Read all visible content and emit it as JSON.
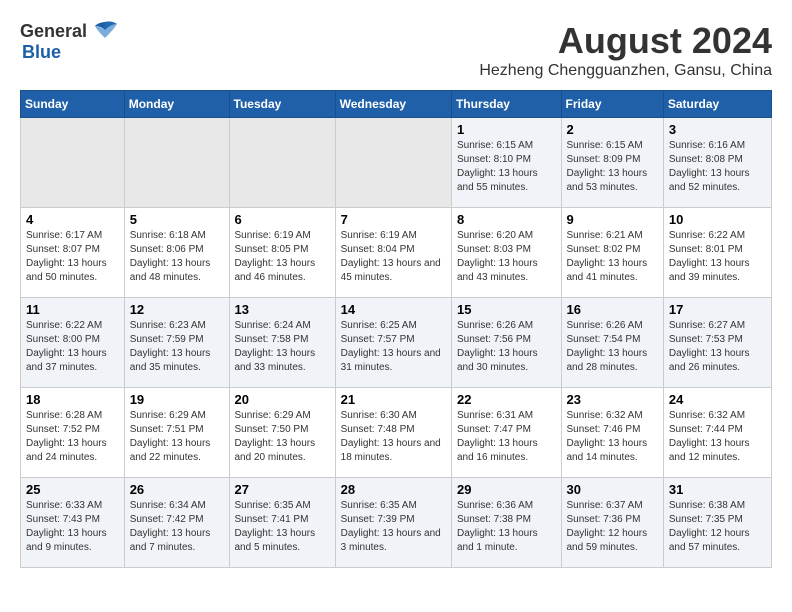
{
  "logo": {
    "general": "General",
    "blue": "Blue"
  },
  "title": "August 2024",
  "subtitle": "Hezheng Chengguanzhen, Gansu, China",
  "days_of_week": [
    "Sunday",
    "Monday",
    "Tuesday",
    "Wednesday",
    "Thursday",
    "Friday",
    "Saturday"
  ],
  "weeks": [
    [
      {
        "day": "",
        "empty": true
      },
      {
        "day": "",
        "empty": true
      },
      {
        "day": "",
        "empty": true
      },
      {
        "day": "",
        "empty": true
      },
      {
        "day": "1",
        "sunrise": "Sunrise: 6:15 AM",
        "sunset": "Sunset: 8:10 PM",
        "daylight": "Daylight: 13 hours and 55 minutes."
      },
      {
        "day": "2",
        "sunrise": "Sunrise: 6:15 AM",
        "sunset": "Sunset: 8:09 PM",
        "daylight": "Daylight: 13 hours and 53 minutes."
      },
      {
        "day": "3",
        "sunrise": "Sunrise: 6:16 AM",
        "sunset": "Sunset: 8:08 PM",
        "daylight": "Daylight: 13 hours and 52 minutes."
      }
    ],
    [
      {
        "day": "4",
        "sunrise": "Sunrise: 6:17 AM",
        "sunset": "Sunset: 8:07 PM",
        "daylight": "Daylight: 13 hours and 50 minutes."
      },
      {
        "day": "5",
        "sunrise": "Sunrise: 6:18 AM",
        "sunset": "Sunset: 8:06 PM",
        "daylight": "Daylight: 13 hours and 48 minutes."
      },
      {
        "day": "6",
        "sunrise": "Sunrise: 6:19 AM",
        "sunset": "Sunset: 8:05 PM",
        "daylight": "Daylight: 13 hours and 46 minutes."
      },
      {
        "day": "7",
        "sunrise": "Sunrise: 6:19 AM",
        "sunset": "Sunset: 8:04 PM",
        "daylight": "Daylight: 13 hours and 45 minutes."
      },
      {
        "day": "8",
        "sunrise": "Sunrise: 6:20 AM",
        "sunset": "Sunset: 8:03 PM",
        "daylight": "Daylight: 13 hours and 43 minutes."
      },
      {
        "day": "9",
        "sunrise": "Sunrise: 6:21 AM",
        "sunset": "Sunset: 8:02 PM",
        "daylight": "Daylight: 13 hours and 41 minutes."
      },
      {
        "day": "10",
        "sunrise": "Sunrise: 6:22 AM",
        "sunset": "Sunset: 8:01 PM",
        "daylight": "Daylight: 13 hours and 39 minutes."
      }
    ],
    [
      {
        "day": "11",
        "sunrise": "Sunrise: 6:22 AM",
        "sunset": "Sunset: 8:00 PM",
        "daylight": "Daylight: 13 hours and 37 minutes."
      },
      {
        "day": "12",
        "sunrise": "Sunrise: 6:23 AM",
        "sunset": "Sunset: 7:59 PM",
        "daylight": "Daylight: 13 hours and 35 minutes."
      },
      {
        "day": "13",
        "sunrise": "Sunrise: 6:24 AM",
        "sunset": "Sunset: 7:58 PM",
        "daylight": "Daylight: 13 hours and 33 minutes."
      },
      {
        "day": "14",
        "sunrise": "Sunrise: 6:25 AM",
        "sunset": "Sunset: 7:57 PM",
        "daylight": "Daylight: 13 hours and 31 minutes."
      },
      {
        "day": "15",
        "sunrise": "Sunrise: 6:26 AM",
        "sunset": "Sunset: 7:56 PM",
        "daylight": "Daylight: 13 hours and 30 minutes."
      },
      {
        "day": "16",
        "sunrise": "Sunrise: 6:26 AM",
        "sunset": "Sunset: 7:54 PM",
        "daylight": "Daylight: 13 hours and 28 minutes."
      },
      {
        "day": "17",
        "sunrise": "Sunrise: 6:27 AM",
        "sunset": "Sunset: 7:53 PM",
        "daylight": "Daylight: 13 hours and 26 minutes."
      }
    ],
    [
      {
        "day": "18",
        "sunrise": "Sunrise: 6:28 AM",
        "sunset": "Sunset: 7:52 PM",
        "daylight": "Daylight: 13 hours and 24 minutes."
      },
      {
        "day": "19",
        "sunrise": "Sunrise: 6:29 AM",
        "sunset": "Sunset: 7:51 PM",
        "daylight": "Daylight: 13 hours and 22 minutes."
      },
      {
        "day": "20",
        "sunrise": "Sunrise: 6:29 AM",
        "sunset": "Sunset: 7:50 PM",
        "daylight": "Daylight: 13 hours and 20 minutes."
      },
      {
        "day": "21",
        "sunrise": "Sunrise: 6:30 AM",
        "sunset": "Sunset: 7:48 PM",
        "daylight": "Daylight: 13 hours and 18 minutes."
      },
      {
        "day": "22",
        "sunrise": "Sunrise: 6:31 AM",
        "sunset": "Sunset: 7:47 PM",
        "daylight": "Daylight: 13 hours and 16 minutes."
      },
      {
        "day": "23",
        "sunrise": "Sunrise: 6:32 AM",
        "sunset": "Sunset: 7:46 PM",
        "daylight": "Daylight: 13 hours and 14 minutes."
      },
      {
        "day": "24",
        "sunrise": "Sunrise: 6:32 AM",
        "sunset": "Sunset: 7:44 PM",
        "daylight": "Daylight: 13 hours and 12 minutes."
      }
    ],
    [
      {
        "day": "25",
        "sunrise": "Sunrise: 6:33 AM",
        "sunset": "Sunset: 7:43 PM",
        "daylight": "Daylight: 13 hours and 9 minutes."
      },
      {
        "day": "26",
        "sunrise": "Sunrise: 6:34 AM",
        "sunset": "Sunset: 7:42 PM",
        "daylight": "Daylight: 13 hours and 7 minutes."
      },
      {
        "day": "27",
        "sunrise": "Sunrise: 6:35 AM",
        "sunset": "Sunset: 7:41 PM",
        "daylight": "Daylight: 13 hours and 5 minutes."
      },
      {
        "day": "28",
        "sunrise": "Sunrise: 6:35 AM",
        "sunset": "Sunset: 7:39 PM",
        "daylight": "Daylight: 13 hours and 3 minutes."
      },
      {
        "day": "29",
        "sunrise": "Sunrise: 6:36 AM",
        "sunset": "Sunset: 7:38 PM",
        "daylight": "Daylight: 13 hours and 1 minute."
      },
      {
        "day": "30",
        "sunrise": "Sunrise: 6:37 AM",
        "sunset": "Sunset: 7:36 PM",
        "daylight": "Daylight: 12 hours and 59 minutes."
      },
      {
        "day": "31",
        "sunrise": "Sunrise: 6:38 AM",
        "sunset": "Sunset: 7:35 PM",
        "daylight": "Daylight: 12 hours and 57 minutes."
      }
    ]
  ]
}
